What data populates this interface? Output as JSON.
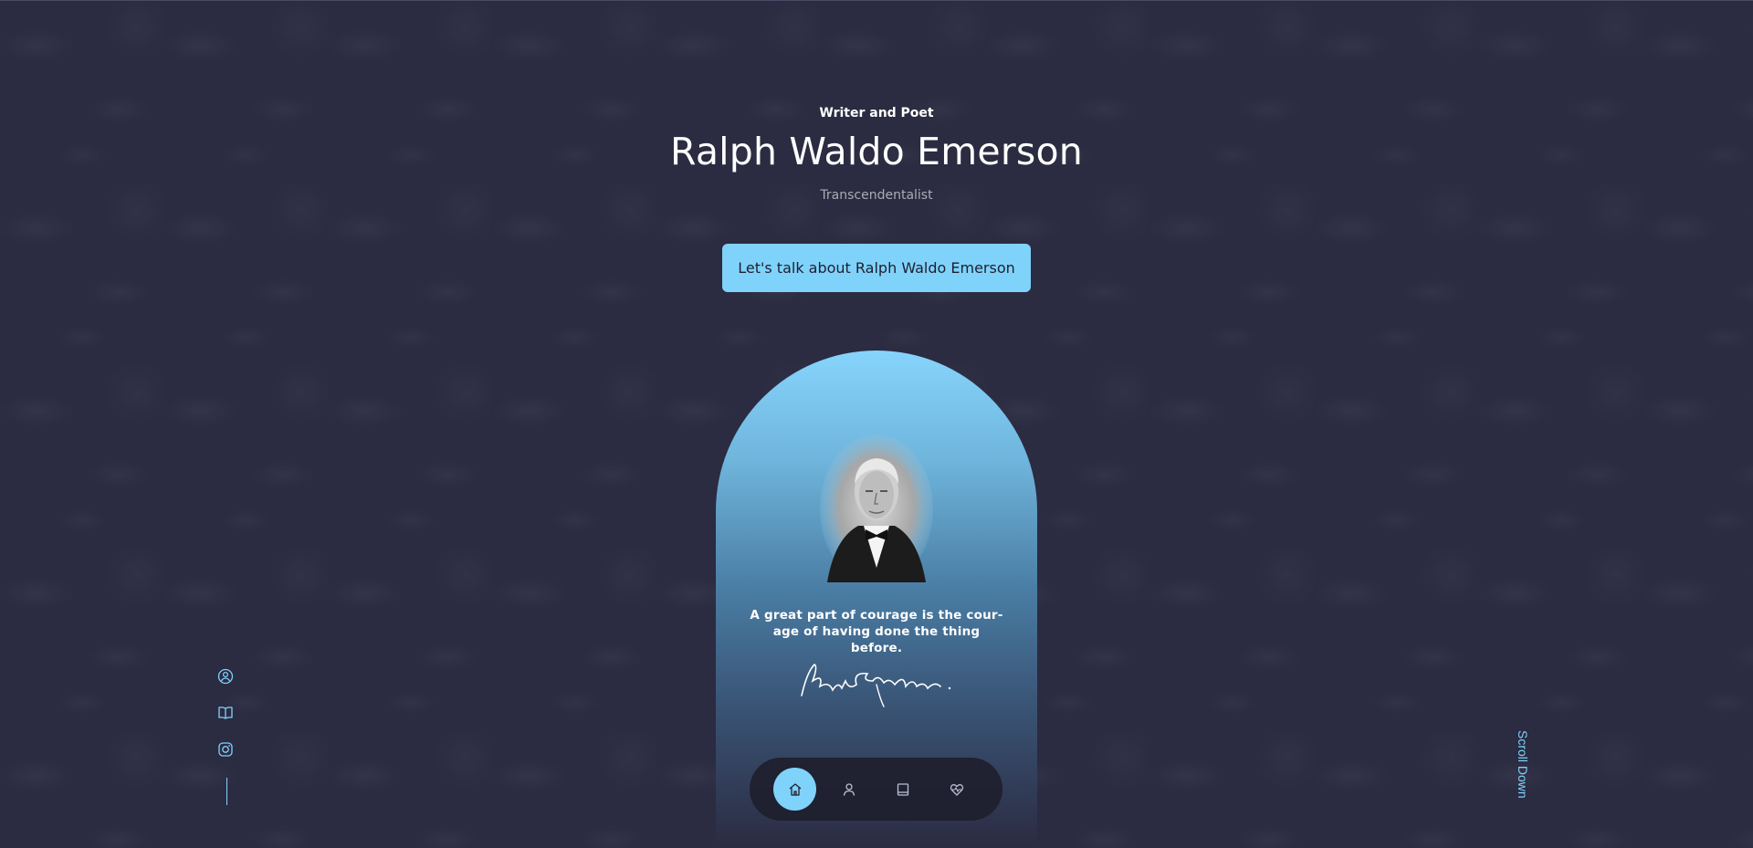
{
  "header": {
    "overline": "Writer and Poet",
    "name": "Ralph Waldo Emerson",
    "tagline": "Transcendentalist"
  },
  "cta": {
    "label": "Let's talk about Ralph Waldo Emerson"
  },
  "portrait": {
    "quote": "A great part of courage is the courage of having done the thing before.",
    "quote_line1": "A great part of courage is the cour-",
    "quote_line2": "age of having done the thing",
    "quote_line3": "before.",
    "signature_icon": "signature-icon"
  },
  "bottom_nav": {
    "items": [
      {
        "icon": "home-icon",
        "active": true
      },
      {
        "icon": "user-icon",
        "active": false
      },
      {
        "icon": "book-icon",
        "active": false
      },
      {
        "icon": "heart-pulse-icon",
        "active": false
      }
    ]
  },
  "social": {
    "items": [
      {
        "icon": "user-circle-icon"
      },
      {
        "icon": "open-book-icon"
      },
      {
        "icon": "instagram-icon"
      }
    ]
  },
  "scroll": {
    "label": "Scroll Down"
  },
  "colors": {
    "background": "#2b2b41",
    "accent": "#7fd3fb",
    "text": "#ffffff"
  }
}
